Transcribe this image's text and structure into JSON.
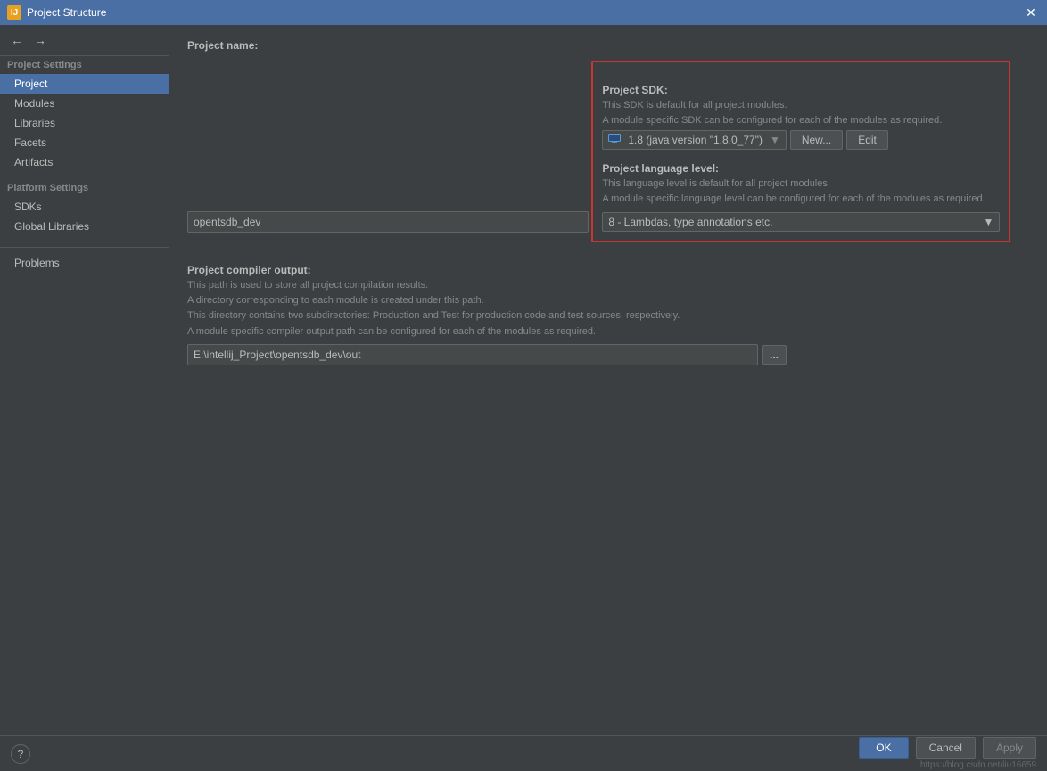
{
  "titleBar": {
    "icon": "IJ",
    "title": "Project Structure",
    "closeLabel": "✕"
  },
  "sidebar": {
    "topButtons": [
      {
        "label": "←",
        "name": "back-button"
      },
      {
        "label": "→",
        "name": "forward-button"
      }
    ],
    "projectSettingsLabel": "Project Settings",
    "items": [
      {
        "label": "Project",
        "id": "project",
        "active": true
      },
      {
        "label": "Modules",
        "id": "modules"
      },
      {
        "label": "Libraries",
        "id": "libraries"
      },
      {
        "label": "Facets",
        "id": "facets"
      },
      {
        "label": "Artifacts",
        "id": "artifacts"
      }
    ],
    "platformSettingsLabel": "Platform Settings",
    "platformItems": [
      {
        "label": "SDKs",
        "id": "sdks"
      },
      {
        "label": "Global Libraries",
        "id": "global-libraries"
      }
    ],
    "bottomItems": [
      {
        "label": "Problems",
        "id": "problems"
      }
    ]
  },
  "mainPanel": {
    "projectName": {
      "label": "Project name:",
      "value": "opentsdb_dev"
    },
    "projectSDK": {
      "label": "Project SDK:",
      "desc1": "This SDK is default for all project modules.",
      "desc2": "A module specific SDK can be configured for each of the modules as required.",
      "sdkValue": "1.8 (java version \"1.8.0_77\")",
      "newButtonLabel": "New...",
      "editButtonLabel": "Edit"
    },
    "projectLanguageLevel": {
      "label": "Project language level:",
      "desc1": "This language level is default for all project modules.",
      "desc2": "A module specific language level can be configured for each of the modules as required.",
      "value": "8 - Lambdas, type annotations etc."
    },
    "projectCompilerOutput": {
      "label": "Project compiler output:",
      "desc1": "This path is used to store all project compilation results.",
      "desc2": "A directory corresponding to each module is created under this path.",
      "desc3": "This directory contains two subdirectories: Production and Test for production code and test sources, respectively.",
      "desc4": "A module specific compiler output path can be configured for each of the modules as required.",
      "value": "E:\\intellij_Project\\opentsdb_dev\\out",
      "browseLabel": "..."
    }
  },
  "bottomBar": {
    "helpLabel": "?",
    "okLabel": "OK",
    "cancelLabel": "Cancel",
    "applyLabel": "Apply",
    "watermark": "https://blog.csdn.net/liu16659"
  }
}
